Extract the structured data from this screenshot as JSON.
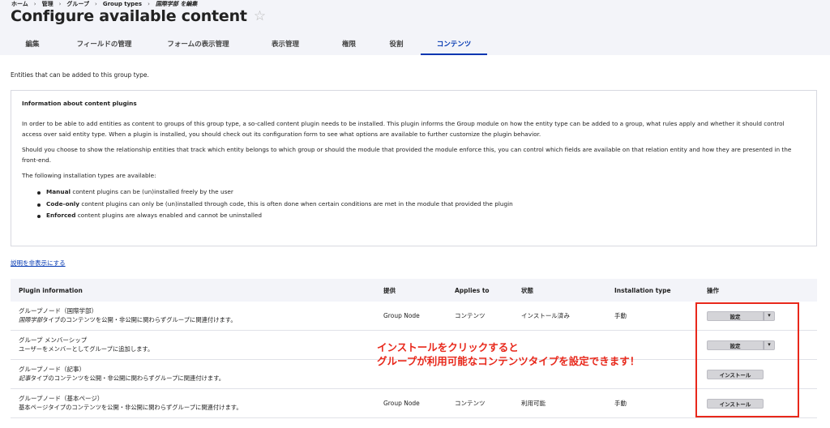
{
  "breadcrumb": [
    "ホーム",
    "管理",
    "グループ",
    "Group types",
    "国際学部 を編集"
  ],
  "page_title": "Configure available content",
  "tabs": [
    {
      "label": "編集",
      "active": false
    },
    {
      "label": "フィールドの管理",
      "active": false
    },
    {
      "label": "フォームの表示管理",
      "active": false
    },
    {
      "label": "表示管理",
      "active": false
    },
    {
      "label": "権限",
      "active": false
    },
    {
      "label": "役割",
      "active": false
    },
    {
      "label": "コンテンツ",
      "active": true
    }
  ],
  "intro_text": "Entities that can be added to this group type.",
  "info": {
    "title": "Information about content plugins",
    "p1": "In order to be able to add entities as content to groups of this group type, a so-called content plugin needs to be installed. This plugin informs the Group module on how the entity type can be added to a group, what rules apply and whether it should control access over said entity type. When a plugin is installed, you should check out its configuration form to see what options are available to further customize the plugin behavior.",
    "p2": "Should you choose to show the relationship entities that track which entity belongs to which group or should the module that provided the module enforce this, you can control which fields are available on that relation entity and how they are presented in the front-end.",
    "p3": "The following installation types are available:",
    "items": [
      {
        "strong": "Manual",
        "text": " content plugins can be (un)installed freely by the user"
      },
      {
        "strong": "Code-only",
        "text": " content plugins can only be (un)installed through code, this is often done when certain conditions are met in the module that provided the plugin"
      },
      {
        "strong": "Enforced",
        "text": " content plugins are always enabled and cannot be uninstalled"
      }
    ]
  },
  "toggle_link": "説明を非表示にする",
  "table": {
    "headers": [
      "Plugin information",
      "提供",
      "Applies to",
      "状態",
      "Installation type",
      "操作"
    ],
    "rows": [
      {
        "name": "グループノード（国際学部）",
        "desc_em": "国際学部",
        "desc_rest": "タイプのコンテンツを公開・非公開に関わらずグループに関連付けます。",
        "provider": "Group Node",
        "applies": "コンテンツ",
        "status": "インストール済み",
        "install_type": "手動",
        "op": "設定",
        "op_kind": "split"
      },
      {
        "name": "グループ メンバーシップ",
        "desc_em": "",
        "desc_rest": "ユーザーをメンバーとしてグループに追加します。",
        "provider": "",
        "applies": "",
        "status": "",
        "install_type": "",
        "op": "設定",
        "op_kind": "split"
      },
      {
        "name": "グループノード（記事）",
        "desc_em": "記事",
        "desc_rest": "タイプのコンテンツを公開・非公開に関わらずグループに関連付けます。",
        "provider": "",
        "applies": "",
        "status": "",
        "install_type": "",
        "op": "インストール",
        "op_kind": "install"
      },
      {
        "name": "グループノード（基本ページ）",
        "desc_em": "",
        "desc_rest": "基本ページタイプのコンテンツを公開・非公開に関わらずグループに関連付けます。",
        "provider": "Group Node",
        "applies": "コンテンツ",
        "status": "利用可能",
        "install_type": "手動",
        "op": "インストール",
        "op_kind": "install"
      }
    ]
  },
  "annotation": {
    "line1": "インストールをクリックすると",
    "line2": "グループが利用可能なコンテンツタイプを設定できます！"
  },
  "colors": {
    "accent": "#0036b1",
    "annotation": "#e8281b",
    "header_bg": "#f3f4f9"
  }
}
